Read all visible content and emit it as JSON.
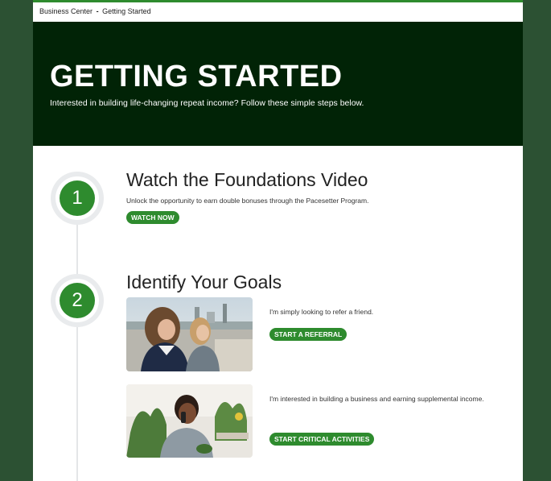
{
  "breadcrumb": {
    "parent": "Business Center",
    "separator": "-",
    "current": "Getting Started"
  },
  "hero": {
    "title": "GETTING STARTED",
    "subtitle": "Interested in building life-changing repeat income? Follow these simple steps below."
  },
  "steps": [
    {
      "number": "1",
      "title": "Watch the Foundations Video",
      "description": "Unlock the opportunity to earn double bonuses through the Pacesetter Program.",
      "button": "WATCH NOW"
    },
    {
      "number": "2",
      "title": "Identify Your Goals",
      "goals": [
        {
          "text": "I'm simply looking to refer a friend.",
          "button": "START A REFERRAL"
        },
        {
          "text": "I'm interested in building a business and earning supplemental income.",
          "button": "START CRITICAL ACTIVITIES"
        }
      ]
    }
  ],
  "colors": {
    "brand_green": "#2e8b2e",
    "hero_bg": "#012306",
    "outer_bg": "#2c5133"
  }
}
